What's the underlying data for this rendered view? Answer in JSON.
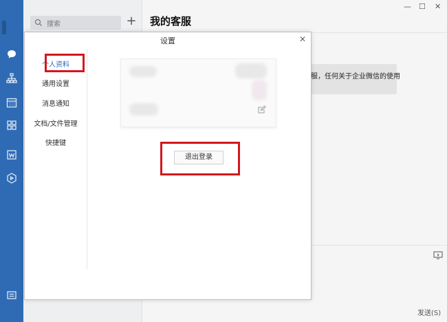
{
  "search": {
    "placeholder": "搜索"
  },
  "chat": {
    "title": "我的客服",
    "bubble_text": "服，任何关于企业微信的使用",
    "send_label": "发送(S)"
  },
  "dialog": {
    "title": "设置",
    "nav_items": [
      "个人资料",
      "通用设置",
      "消息通知",
      "文档/文件管理",
      "快捷键"
    ],
    "logout_label": "退出登录"
  },
  "colors": {
    "nav_blue": "#2f6bb5",
    "highlight_red": "#d4161d",
    "active_blue": "#2a6cc0"
  }
}
